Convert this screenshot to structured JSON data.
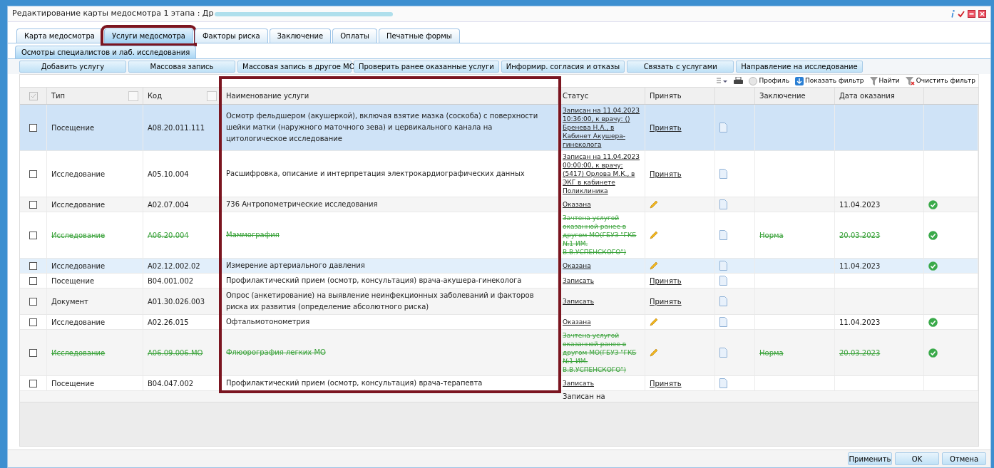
{
  "window": {
    "title": "Редактирование карты медосмотра 1 этапа : Др"
  },
  "tabs": [
    {
      "label": "Карта медосмотра",
      "selected": false,
      "highlighted": false
    },
    {
      "label": "Услуги медосмотра",
      "selected": true,
      "highlighted": true
    },
    {
      "label": "Факторы риска",
      "selected": false,
      "highlighted": false
    },
    {
      "label": "Заключение",
      "selected": false,
      "highlighted": false
    },
    {
      "label": "Оплаты",
      "selected": false,
      "highlighted": false
    },
    {
      "label": "Печатные формы",
      "selected": false,
      "highlighted": false
    }
  ],
  "subtabs": [
    {
      "label": "Осмотры специалистов и лаб. исследования",
      "selected": true
    }
  ],
  "actions": [
    "Добавить услугу",
    "Массовая запись",
    "Массовая запись в другое МО",
    "Проверить ранее оказанные услуги",
    "Информир. согласия и отказы",
    "Связать с услугами",
    "Направление на исследование"
  ],
  "toolbar": [
    {
      "kind": "columns"
    },
    {
      "kind": "print"
    },
    {
      "kind": "profile",
      "label": "Профиль"
    },
    {
      "kind": "filter",
      "label": "Показать фильтр"
    },
    {
      "kind": "find",
      "label": "Найти"
    },
    {
      "kind": "clear",
      "label": "Очистить фильтр"
    }
  ],
  "table": {
    "columns": [
      {
        "label": "Тип"
      },
      {
        "label": "Код"
      },
      {
        "label": "Наименование услуги",
        "highlighted": true
      },
      {
        "label": "Статус"
      },
      {
        "label": "Принять"
      },
      {
        "label": "Заключение"
      },
      {
        "label": "Дата оказания"
      }
    ],
    "rows": [
      {
        "selected": true,
        "replaced": false,
        "checked": false,
        "type": "Посещение",
        "code": "A08.20.011.111",
        "name": "Осмотр фельдшером (акушеркой), включая взятие мазка (соскоба) с поверхности шейки матки (наружного маточного зева) и цервикального канала на цитологическое исследование",
        "status": "Записан на 11.04.2023 10:36:00, к врачу: () Бренева Н.А., в Кабинет Акушера-гинеколога",
        "accept": {
          "kind": "link",
          "label": "Принять"
        },
        "done": false
      },
      {
        "selected": false,
        "replaced": false,
        "checked": false,
        "type": "Исследование",
        "code": "A05.10.004",
        "name": "Расшифровка, описание и интерпретация электрокардиографических данных",
        "status": "Записан на 11.04.2023 00:00:00, к врачу: (5417) Орлова М.К., в ЭКГ в кабинете Поликлиника",
        "accept": {
          "kind": "link",
          "label": "Принять"
        },
        "done": false
      },
      {
        "selected": false,
        "replaced": false,
        "checked": false,
        "type": "Исследование",
        "code": "A02.07.004",
        "name": "736 Антропометрические исследования",
        "status": "Оказана",
        "accept": {
          "kind": "edit"
        },
        "date": "11.04.2023",
        "done": true
      },
      {
        "selected": false,
        "replaced": true,
        "checked": false,
        "type": "Исследование",
        "code": "A06.20.004",
        "name": "Маммография",
        "status": "Зачтена услугой оказанной ранее в другом МО(ГБУЗ \"ГКБ №1 ИМ. В.В.УСПЕНСКОГО\")",
        "accept": {
          "kind": "edit"
        },
        "conclusion": "Норма",
        "date": "20.03.2023",
        "done": true
      },
      {
        "selected": false,
        "hovered": true,
        "replaced": false,
        "checked": false,
        "type": "Исследование",
        "code": "A02.12.002.02",
        "name": "Измерение артериального давления",
        "status": "Оказана",
        "accept": {
          "kind": "edit"
        },
        "date": "11.04.2023",
        "done": true
      },
      {
        "selected": false,
        "replaced": false,
        "checked": false,
        "type": "Посещение",
        "code": "B04.001.002",
        "name": "Профилактический прием (осмотр, консультация) врача-акушера-гинеколога",
        "status": "Записать",
        "accept": {
          "kind": "link",
          "label": "Принять"
        },
        "done": false
      },
      {
        "selected": false,
        "replaced": false,
        "checked": false,
        "type": "Документ",
        "code": "A01.30.026.003",
        "name": "Опрос (анкетирование) на выявление неинфекционных заболеваний и факторов риска их развития (определение абсолютного риска)",
        "status": "Записать",
        "accept": {
          "kind": "link",
          "label": "Принять"
        },
        "done": false
      },
      {
        "selected": false,
        "replaced": false,
        "checked": false,
        "type": "Исследование",
        "code": "A02.26.015",
        "name": "Офтальмотонометрия",
        "status": "Оказана",
        "accept": {
          "kind": "edit"
        },
        "date": "11.04.2023",
        "done": true
      },
      {
        "selected": false,
        "replaced": true,
        "checked": false,
        "type": "Исследование",
        "code": "A06.09.006.МО",
        "name": "Флюорография легких МО",
        "status": "Зачтена услугой оказанной ранее в другом МО(ГБУЗ \"ГКБ №1 ИМ. В.В.УСПЕНСКОГО\")",
        "accept": {
          "kind": "edit"
        },
        "conclusion": "Норма",
        "date": "20.03.2023",
        "done": true
      },
      {
        "selected": false,
        "replaced": false,
        "checked": false,
        "type": "Посещение",
        "code": "B04.047.002",
        "name": "Профилактический прием (осмотр, консультация) врача-терапевта",
        "status": "Записать",
        "accept": {
          "kind": "link",
          "label": "Принять"
        },
        "done": false
      }
    ],
    "cut_row": {
      "status": "Записан на"
    }
  },
  "footer_buttons": [
    "Применить",
    "OK",
    "Отмена"
  ]
}
